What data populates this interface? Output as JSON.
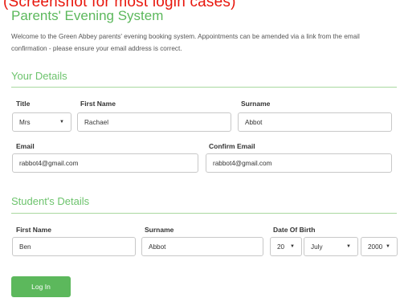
{
  "annotation": "(Screenshot for most login cases)",
  "page": {
    "title": "Parents' Evening System",
    "intro": "Welcome to the Green Abbey parents' evening booking system. Appointments can be amended via a link from the email confirmation - please ensure your email address is correct."
  },
  "your_details": {
    "heading": "Your Details",
    "title_label": "Title",
    "title_value": "Mrs",
    "first_name_label": "First Name",
    "first_name_value": "Rachael",
    "surname_label": "Surname",
    "surname_value": "Abbot",
    "email_label": "Email",
    "email_value": "rabbot4@gmail.com",
    "confirm_email_label": "Confirm Email",
    "confirm_email_value": "rabbot4@gmail.com"
  },
  "student_details": {
    "heading": "Student's Details",
    "first_name_label": "First Name",
    "first_name_value": "Ben",
    "surname_label": "Surname",
    "surname_value": "Abbot",
    "dob_label": "Date Of Birth",
    "dob_day": "20",
    "dob_month": "July",
    "dob_year": "2000"
  },
  "login_button": "Log In",
  "icons": {
    "dropdown": "caret-down-icon"
  },
  "colors": {
    "accent": "#5cb85c",
    "annotation": "#e8160c"
  }
}
